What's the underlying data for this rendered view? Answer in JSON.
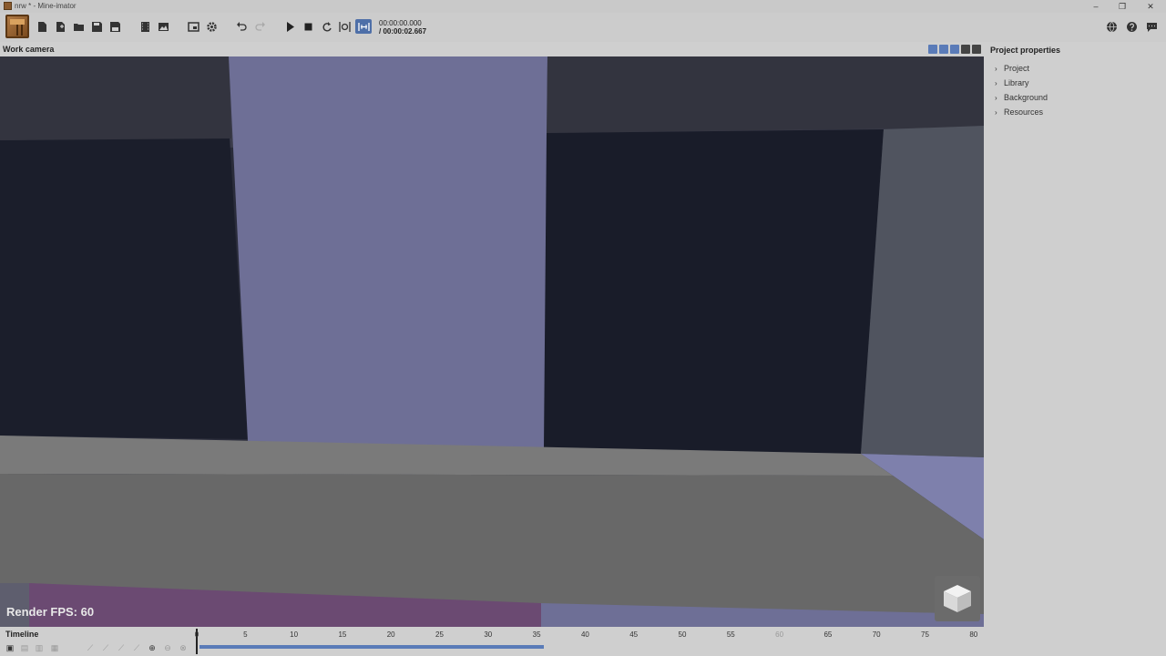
{
  "window": {
    "title": "nrw * - Mine-imator",
    "minimize_glyph": "–",
    "maximize_glyph": "❐",
    "close_glyph": "✕"
  },
  "toolbar": {
    "icons": [
      "new-project-icon",
      "new-file-icon",
      "open-folder-icon",
      "save-icon",
      "save-as-icon",
      "render-movie-icon",
      "render-image-icon",
      "window-icon",
      "settings-icon",
      "undo-icon",
      "redo-icon",
      "play-icon",
      "stop-icon",
      "loop-icon",
      "seamless-loop-icon",
      "marker-icon"
    ],
    "time_current": "00:00:00.000",
    "time_total": "/ 00:00:02.667",
    "right_icons": [
      "world-icon",
      "help-icon",
      "chat-icon"
    ]
  },
  "viewport": {
    "title": "Work camera",
    "fps_label": "Render FPS: 60"
  },
  "panel": {
    "title": "Project properties",
    "items": [
      {
        "label": "Project"
      },
      {
        "label": "Library"
      },
      {
        "label": "Background"
      },
      {
        "label": "Resources"
      }
    ]
  },
  "timeline": {
    "title": "Timeline",
    "ticks": [
      "0",
      "5",
      "10",
      "15",
      "20",
      "25",
      "30",
      "35",
      "40",
      "45",
      "50",
      "55",
      "60",
      "65",
      "70",
      "75",
      "80"
    ],
    "muted_tick": "60",
    "progress_fraction": 0.44
  },
  "colors": {
    "accent": "#4e6fa8",
    "timeline_bar": "#5a7bb8",
    "sky_light": "#6e6f96",
    "dark_block": "#1a1c2a",
    "floor_gray": "#6c6c6c",
    "purple_floor": "#6b4a72"
  }
}
